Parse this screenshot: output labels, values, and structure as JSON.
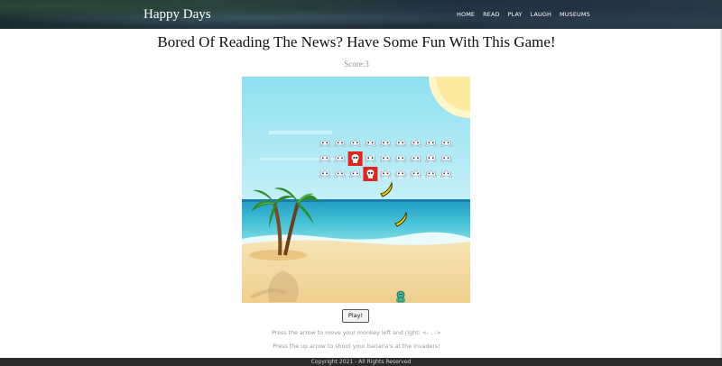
{
  "header": {
    "brand": "Happy Days",
    "nav": [
      "HOME",
      "READ",
      "PLAY",
      "LAUGH",
      "MUSEUMS"
    ]
  },
  "main": {
    "title": "Bored Of Reading The News? Have Some Fun With This Game!",
    "score_label": "Score:",
    "score_value": "3",
    "play_button": "Play!",
    "instructions": [
      "Press the arrow to move your monkey left and right: <- , ->",
      "Press the up arrow to shoot your banana's at the invaders!"
    ]
  },
  "game": {
    "invader_grid": {
      "rows": 3,
      "cols": 9,
      "destroyed": [
        [
          1,
          2
        ],
        [
          2,
          3
        ]
      ]
    },
    "bananas_in_flight": 2,
    "player": "monkey",
    "icons": [
      "space-invader-icon",
      "skull-explosion-icon",
      "banana-icon",
      "monkey-icon",
      "palm-tree-icon",
      "sun-icon"
    ]
  },
  "footer": {
    "copyright": "Copyright 2021 - All Rights Reserved"
  },
  "colors": {
    "header_bg": "#1f2b38",
    "sky": "#a9e7f3",
    "sea": "#3fb8cf",
    "sand": "#f3d9a0",
    "hit": "#e3241d"
  }
}
